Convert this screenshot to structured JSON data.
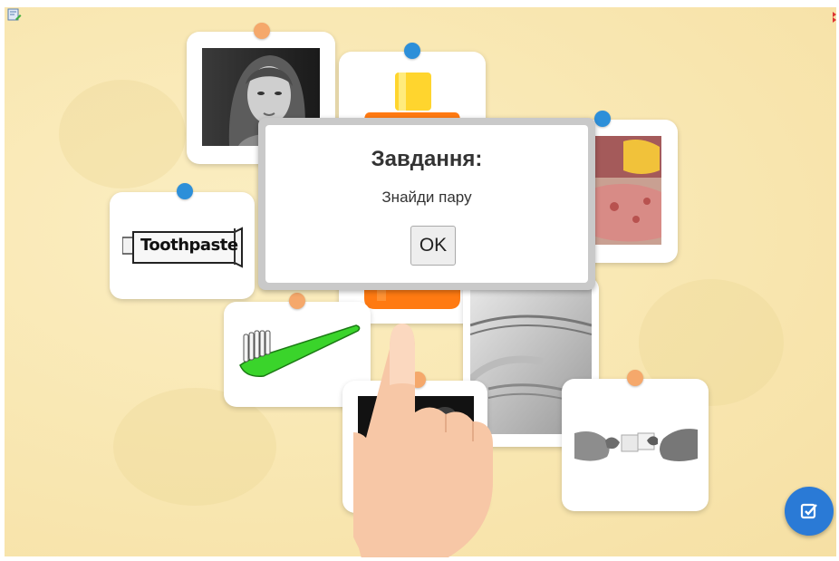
{
  "window": {
    "help_icon": "edit-help-icon",
    "corner_icon": "resize-icon"
  },
  "dialog": {
    "title": "Завдання:",
    "message": "Знайди пару",
    "ok_label": "OK"
  },
  "cards": [
    {
      "name": "card-woman-portrait",
      "image": "woman-portrait-photo"
    },
    {
      "name": "card-shampoo-bottle",
      "image": "shampoo-bottle"
    },
    {
      "name": "card-soap-bars",
      "image": "soap-photo"
    },
    {
      "name": "card-toothpaste",
      "image": "toothpaste-tube",
      "label": "Toothpaste"
    },
    {
      "name": "card-toothbrush",
      "image": "toothbrush"
    },
    {
      "name": "card-towels",
      "image": "towels-photo"
    },
    {
      "name": "card-hairbrush",
      "image": "dark-photo"
    },
    {
      "name": "card-puzzle-hands",
      "image": "puzzle-hands-photo"
    }
  ],
  "overlay": {
    "hand_icon": "pointing-hand-icon"
  },
  "check_button": {
    "icon": "check-square-icon"
  },
  "colors": {
    "board": "#f9e8b4",
    "pin_orange": "#f5a86b",
    "pin_blue": "#2d8fd9",
    "check_button": "#2a7ad6",
    "toothbrush_green": "#3ad42b",
    "bottle_orange": "#ff7a12",
    "bottle_yellow": "#ffd52e"
  }
}
